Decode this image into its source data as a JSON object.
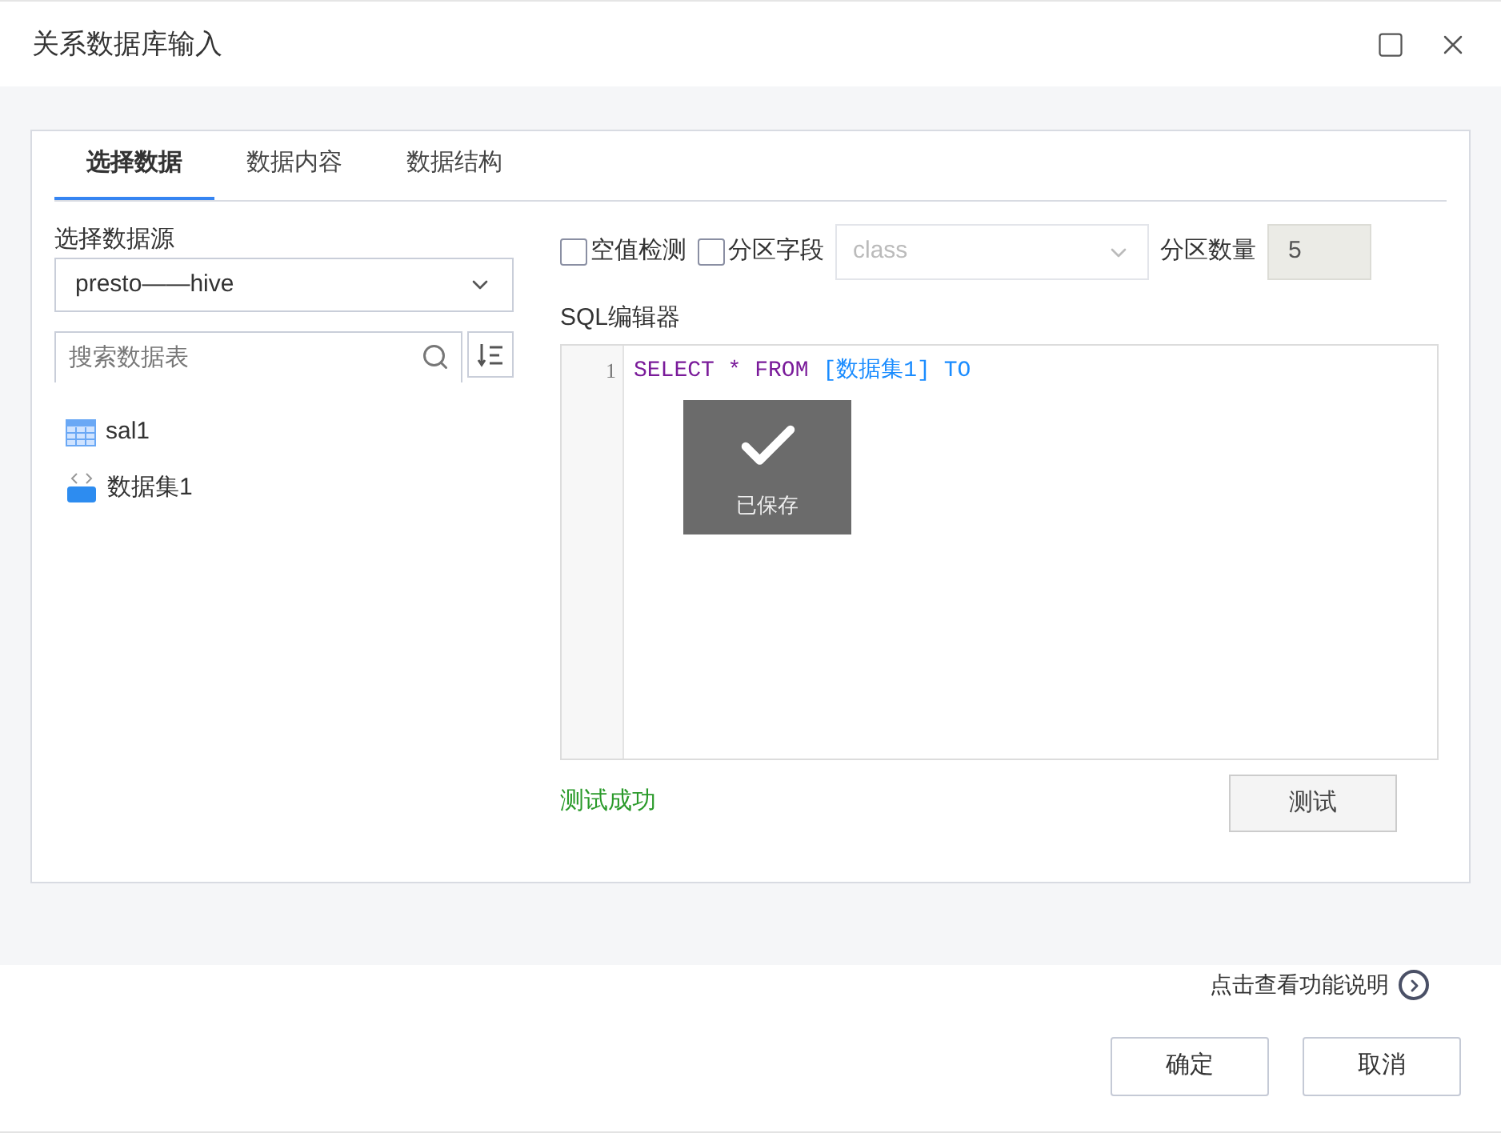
{
  "window": {
    "title": "关系数据库输入"
  },
  "tabs": [
    {
      "label": "选择数据",
      "selected": true
    },
    {
      "label": "数据内容",
      "selected": false
    },
    {
      "label": "数据结构",
      "selected": false
    }
  ],
  "source": {
    "label": "选择数据源",
    "value": "presto——hive"
  },
  "search": {
    "placeholder": "搜索数据表"
  },
  "tables": [
    {
      "name": "sal1",
      "kind": "table"
    },
    {
      "name": "数据集1",
      "kind": "sql"
    }
  ],
  "options": {
    "null_check": {
      "label": "空值检测",
      "checked": false
    },
    "partition_field": {
      "label": "分区字段",
      "checked": false,
      "placeholder": "class"
    },
    "partition_count": {
      "label": "分区数量",
      "value": "5"
    }
  },
  "editor": {
    "label": "SQL编辑器",
    "lines": [
      {
        "number": "1",
        "tokens": [
          {
            "text": "SELECT * FROM",
            "kind": "keyword"
          },
          {
            "text": "[数据集1] TO",
            "kind": "identifier"
          }
        ]
      }
    ]
  },
  "toast": {
    "text": "已保存"
  },
  "status": {
    "text": "测试成功"
  },
  "test_button": "测试",
  "help_link": "点击查看功能说明",
  "buttons": [
    {
      "label": "确定"
    },
    {
      "label": "取消"
    }
  ]
}
